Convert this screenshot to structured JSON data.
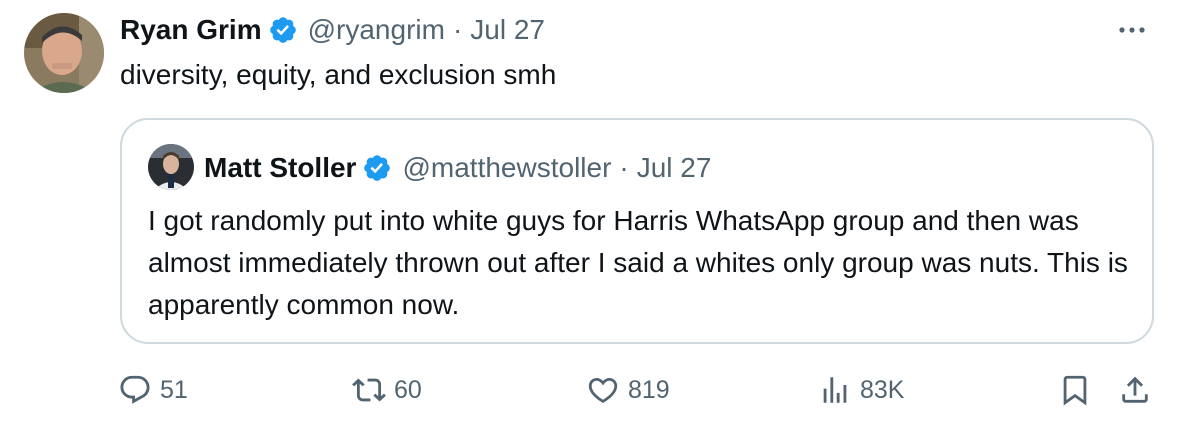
{
  "tweet": {
    "author_name": "Ryan Grim",
    "author_handle": "@ryangrim",
    "separator": "·",
    "date": "Jul 27",
    "text": "diversity, equity, and exclusion smh",
    "avatar_icon": "avatar-photo",
    "more_icon": "more-dots-icon"
  },
  "quoted": {
    "author_name": "Matt Stoller",
    "author_handle": "@matthewstoller",
    "separator": "·",
    "date": "Jul 27",
    "text": "I got randomly put into white guys for Harris WhatsApp group and then was almost immediately thrown out after I said a whites only group was nuts. This is apparently common now."
  },
  "actions": {
    "replies": "51",
    "reposts": "60",
    "likes": "819",
    "views": "83K"
  },
  "colors": {
    "text": "#0f1419",
    "muted": "#536471",
    "verified": "#1d9bf0",
    "border": "#cfd9de"
  }
}
